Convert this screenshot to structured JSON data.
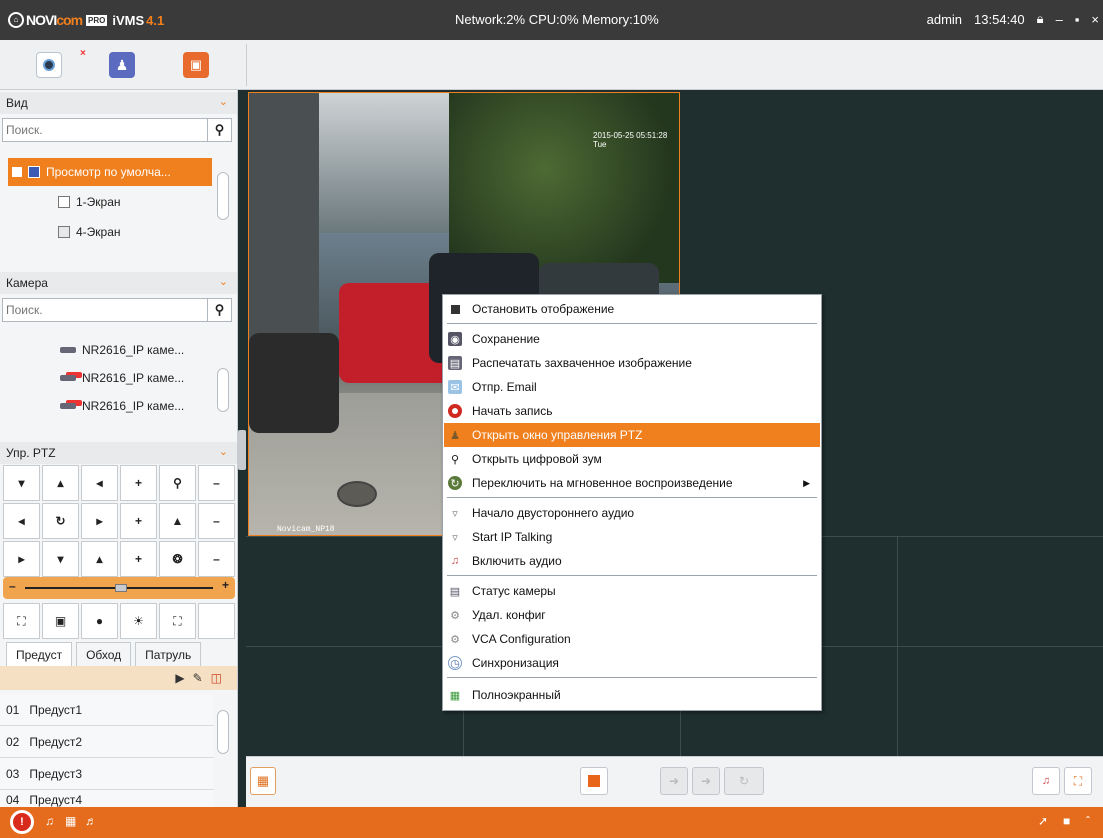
{
  "titlebar": {
    "logo_brand_a": "NOVI",
    "logo_brand_b": "com",
    "logo_pro": "PRO",
    "logo_app": "iVMS",
    "logo_version": "4.1",
    "system_status": "Network:2% CPU:0% Memory:10%",
    "user": "admin",
    "time": "13:54:40"
  },
  "left_panel": {
    "view_section": {
      "title": "Вид",
      "search_placeholder": "Поиск.",
      "items": [
        {
          "label": "Просмотр по умолча..."
        },
        {
          "label": "1-Экран"
        },
        {
          "label": "4-Экран"
        }
      ]
    },
    "camera_section": {
      "title": "Камера",
      "search_placeholder": "Поиск.",
      "items": [
        {
          "label": "NR2616_IP каме..."
        },
        {
          "label": "NR2616_IP каме..."
        },
        {
          "label": "NR2616_IP каме..."
        }
      ]
    },
    "ptz_section": {
      "title": "Упр. PTZ",
      "tabs": [
        "Предуст",
        "Обход",
        "Патруль"
      ],
      "presets": [
        {
          "num": "01",
          "name": "Предуст1"
        },
        {
          "num": "02",
          "name": "Предуст2"
        },
        {
          "num": "03",
          "name": "Предуст3"
        },
        {
          "num": "04",
          "name": "Предуст4"
        }
      ]
    }
  },
  "video": {
    "timestamp": "2015-05-25 05:51:28 Tue",
    "camera_name": "Novicam_NP18"
  },
  "context_menu": {
    "items": [
      {
        "label": "Остановить отображение",
        "icon": "stop-icon"
      },
      {
        "label": "Сохранение",
        "icon": "camera-capture-icon"
      },
      {
        "label": "Распечатать захваченное изображение",
        "icon": "printer-icon"
      },
      {
        "label": "Отпр. Email",
        "icon": "email-icon"
      },
      {
        "label": "Начать запись",
        "icon": "record-icon"
      },
      {
        "label": "Открыть окно управления PTZ",
        "icon": "ptz-icon"
      },
      {
        "label": "Открыть цифровой зум",
        "icon": "zoom-icon"
      },
      {
        "label": "Переключить на мгновенное воспроизведение",
        "icon": "instant-playback-icon"
      },
      {
        "label": "Начало двустороннего аудио",
        "icon": "microphone-icon"
      },
      {
        "label": "Start IP Talking",
        "icon": "microphone-icon"
      },
      {
        "label": "Включить аудио",
        "icon": "audio-icon"
      },
      {
        "label": "Статус камеры",
        "icon": "camera-status-icon"
      },
      {
        "label": "Удал. конфиг",
        "icon": "gear-icon"
      },
      {
        "label": "VCA Configuration",
        "icon": "gear-icon"
      },
      {
        "label": "Синхронизация",
        "icon": "sync-icon"
      },
      {
        "label": "Полноэкранный",
        "icon": "fullscreen-icon"
      }
    ],
    "highlighted": "Открыть окно управления PTZ"
  },
  "colors": {
    "accent": "#f07f1d",
    "titlebar": "#3a3a3a",
    "statusbar": "#e56c1d",
    "video_bg": "#1f2f2f"
  }
}
